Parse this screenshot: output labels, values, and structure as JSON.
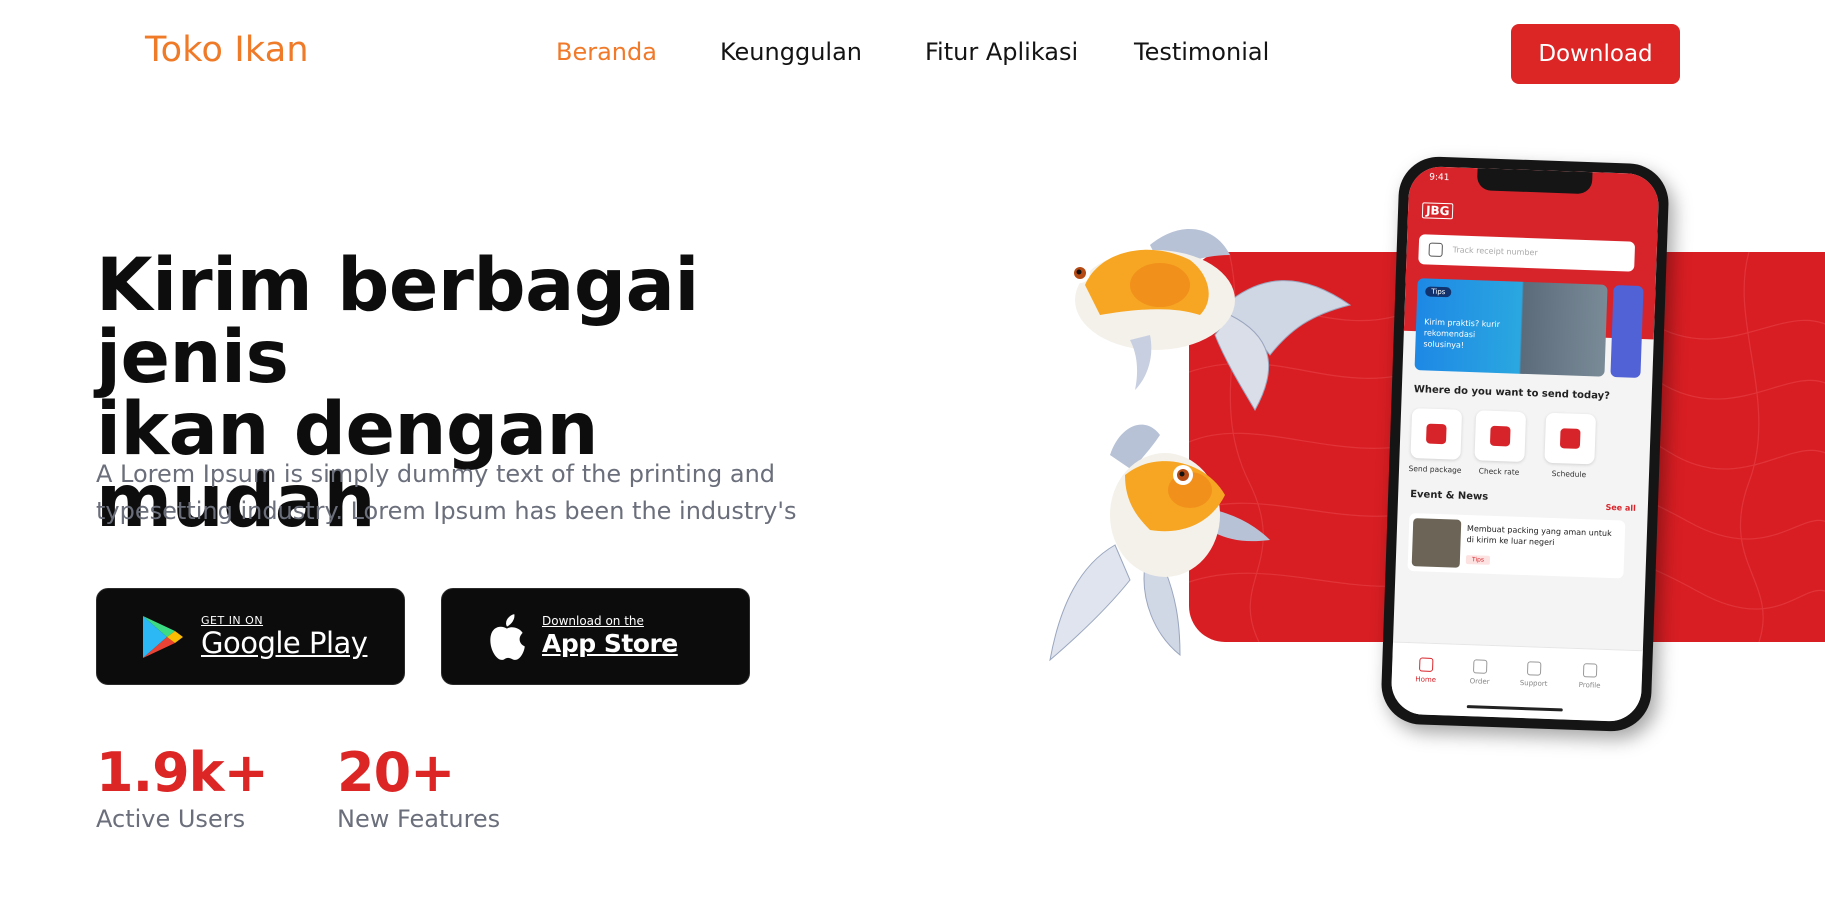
{
  "brand": {
    "logo": "Toko Ikan"
  },
  "nav": {
    "items": [
      {
        "label": "Beranda",
        "active": true
      },
      {
        "label": "Keunggulan"
      },
      {
        "label": "Fitur Aplikasi"
      },
      {
        "label": "Testimonial"
      }
    ],
    "download_label": "Download"
  },
  "hero": {
    "title_line1": "Kirim berbagai jenis",
    "title_line2": "ikan dengan mudah",
    "description": "A Lorem Ipsum is simply dummy text of the printing and typesetting industry. Lorem Ipsum has been the industry's"
  },
  "stores": {
    "google": {
      "small": "GET IN ON",
      "big": "Google Play",
      "icon": "google-play-icon"
    },
    "apple": {
      "small": "Download on the",
      "big": "App Store",
      "icon": "apple-icon"
    }
  },
  "stats": [
    {
      "value": "1.9k+",
      "label": "Active Users"
    },
    {
      "value": "20+",
      "label": "New Features"
    }
  ],
  "phone": {
    "time": "9:41",
    "brand": "JBG",
    "search_placeholder": "Track receipt number",
    "banner_tag": "Tips",
    "banner_text": "Kirim praktis? kurir rekomendasi solusinya!",
    "question": "Where do you want to send today?",
    "services": [
      "Send package",
      "Check rate",
      "Schedule"
    ],
    "events_title": "Event & News",
    "see_all": "See all",
    "news_title": "Membuat packing yang aman untuk di kirim ke luar negeri",
    "news_tag": "Tips",
    "tabs": [
      "Home",
      "Order",
      "Support",
      "Profile"
    ]
  },
  "colors": {
    "accent_orange": "#f07a2a",
    "primary_red": "#dc2626",
    "text_dark": "#0d0d0d",
    "text_muted": "#6b6f7b"
  }
}
